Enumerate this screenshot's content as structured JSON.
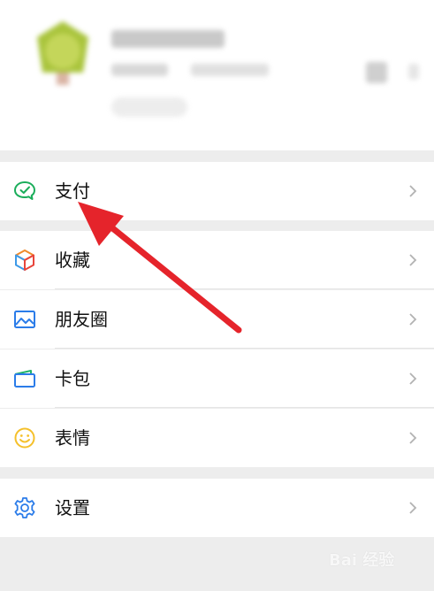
{
  "menu": {
    "pay": {
      "label": "支付",
      "icon": "wechat-pay-icon"
    },
    "favorites": {
      "label": "收藏",
      "icon": "favorites-cube-icon"
    },
    "moments": {
      "label": "朋友圈",
      "icon": "moments-image-icon"
    },
    "cards": {
      "label": "卡包",
      "icon": "card-wallet-icon"
    },
    "stickers": {
      "label": "表情",
      "icon": "smiley-icon"
    },
    "settings": {
      "label": "设置",
      "icon": "gear-icon"
    }
  },
  "watermark": {
    "text": "Bai 经验"
  },
  "colors": {
    "background": "#ededed",
    "pay_green": "#1aad5a",
    "settings_blue": "#2b7ce9",
    "sticker_yellow": "#f5c02b",
    "annotation_red": "#e5242b"
  }
}
